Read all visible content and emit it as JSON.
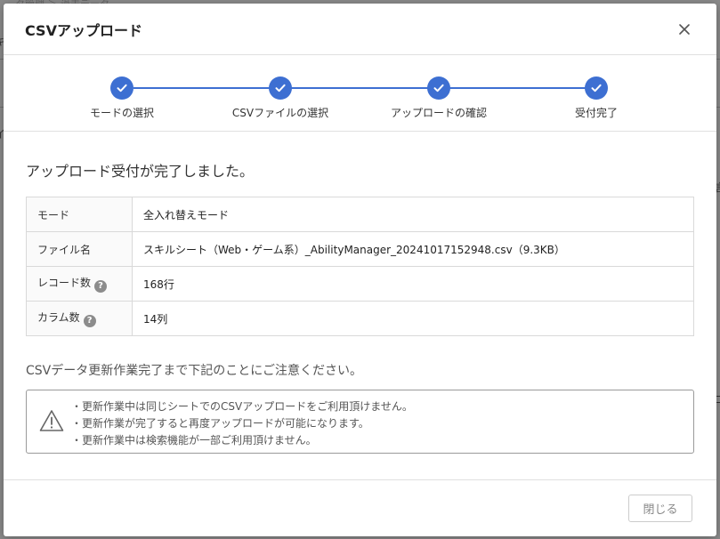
{
  "background": {
    "breadcrumb": "…タ管理 ＞ 過去データ",
    "edge_glyphs": [
      "キ",
      "イ",
      "言",
      "ゴ"
    ]
  },
  "modal": {
    "title": "CSVアップロード",
    "close_icon": "close-icon"
  },
  "stepper": {
    "accent_color": "#3d6fd2",
    "steps": [
      {
        "label": "モードの選択",
        "status": "complete"
      },
      {
        "label": "CSVファイルの選択",
        "status": "complete"
      },
      {
        "label": "アップロードの確認",
        "status": "complete"
      },
      {
        "label": "受付完了",
        "status": "complete"
      }
    ]
  },
  "result": {
    "message": "アップロード受付が完了しました。",
    "rows": [
      {
        "key": "モード",
        "value": "全入れ替えモード",
        "help": false
      },
      {
        "key": "ファイル名",
        "value": "スキルシート（Web・ゲーム系）_AbilityManager_20241017152948.csv（9.3KB）",
        "help": false
      },
      {
        "key": "レコード数",
        "value": "168行",
        "help": true
      },
      {
        "key": "カラム数",
        "value": "14列",
        "help": true
      }
    ]
  },
  "notice": {
    "title": "CSVデータ更新作業完了まで下記のことにご注意ください。",
    "icon": "warning-icon",
    "items": [
      "・更新作業中は同じシートでのCSVアップロードをご利用頂けません。",
      "・更新作業が完了すると再度アップロードが可能になります。",
      "・更新作業中は検索機能が一部ご利用頂けません。"
    ]
  },
  "footer": {
    "close_label": "閉じる"
  }
}
